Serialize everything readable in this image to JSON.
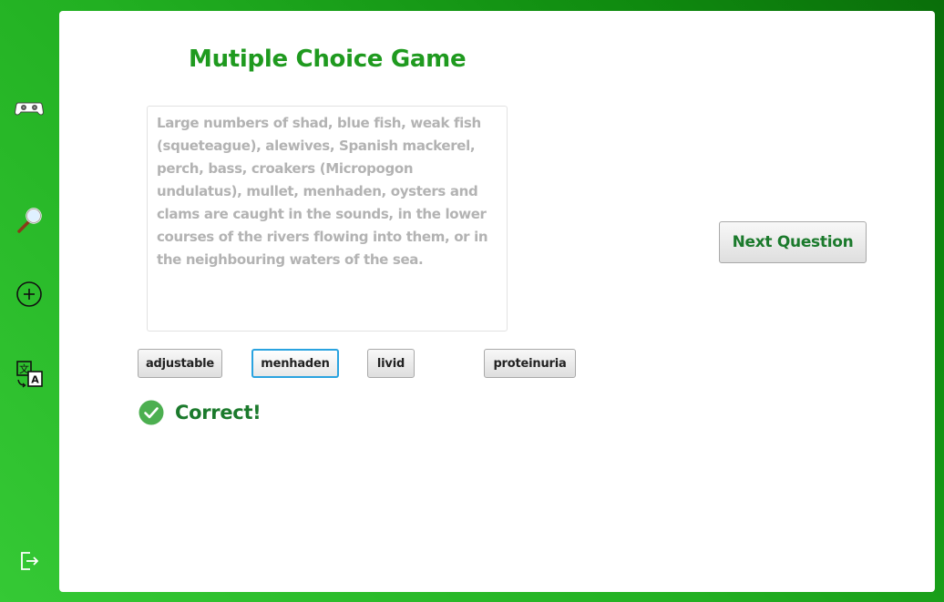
{
  "app": {
    "title": "Mutiple Choice Game"
  },
  "sidebar": {
    "items": [
      {
        "icon": "gamepad-icon"
      },
      {
        "icon": "search-icon"
      },
      {
        "icon": "add-icon"
      },
      {
        "icon": "translate-icon"
      },
      {
        "icon": "logout-icon"
      }
    ]
  },
  "question": {
    "text": "Large numbers of shad, blue fish, weak fish (squeteague), alewives, Spanish mackerel, perch, bass, croakers (Micropogon undulatus), mullet, menhaden, oysters and clams are caught in the sounds, in the lower courses of the rivers flowing into them, or in the neighbouring waters of the sea."
  },
  "options": [
    {
      "label": "adjustable",
      "selected": false
    },
    {
      "label": "menhaden",
      "selected": true
    },
    {
      "label": "livid",
      "selected": false
    },
    {
      "label": "proteinuria",
      "selected": false
    }
  ],
  "next_button": {
    "label": "Next Question"
  },
  "result": {
    "text": "Correct!",
    "icon": "check-circle-icon"
  },
  "colors": {
    "accent_green": "#1f9a1f",
    "dark_green": "#1b7a2c",
    "selected_border": "#2aa3e0",
    "check_green": "#4caf50"
  }
}
